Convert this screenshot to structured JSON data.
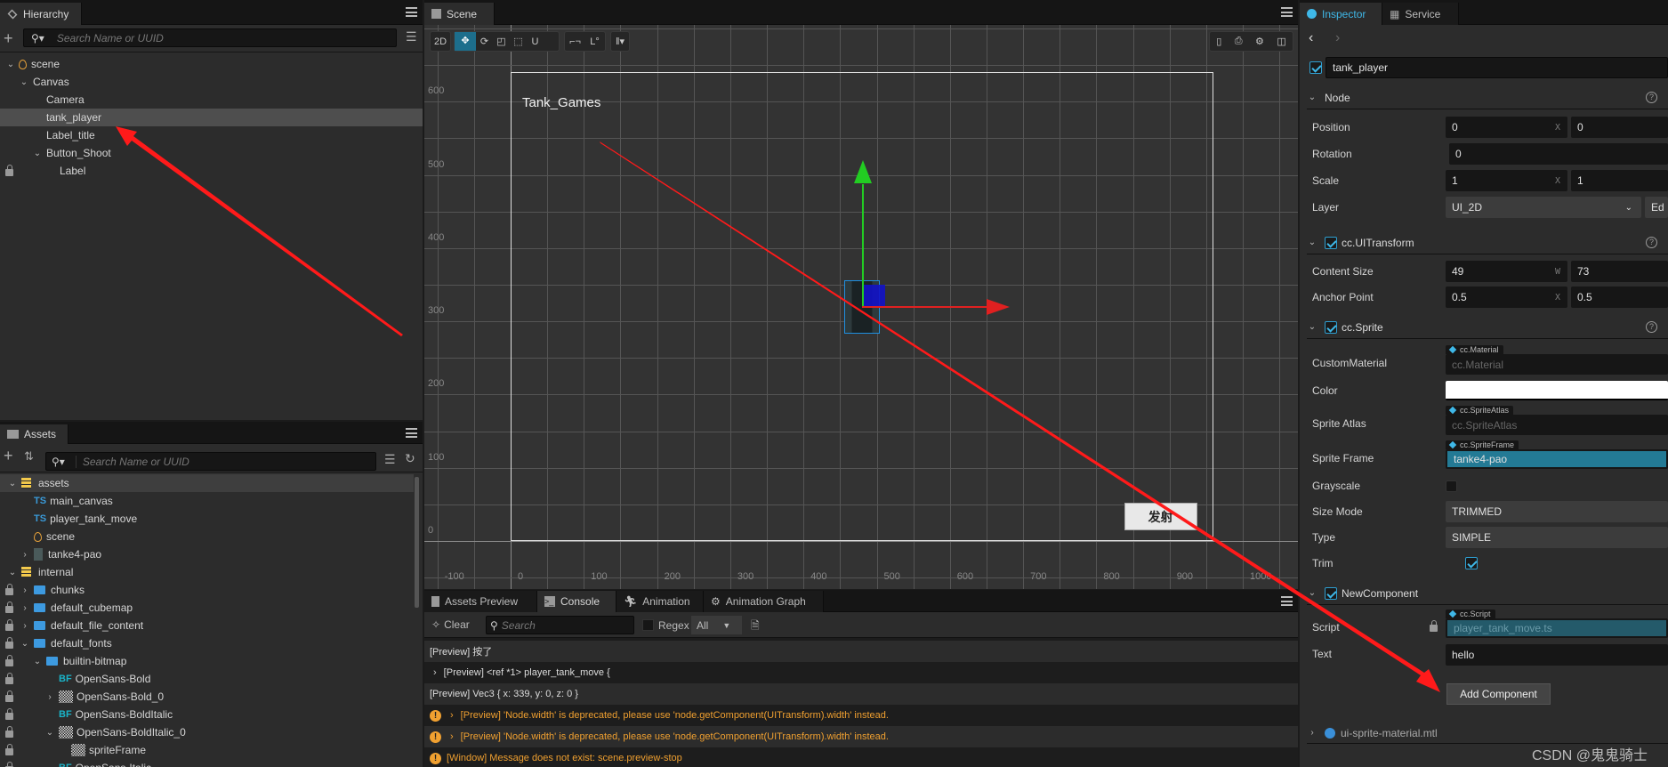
{
  "hierarchy": {
    "title": "Hierarchy",
    "search_placeholder": "Search Name or UUID",
    "items": [
      {
        "label": "scene",
        "indent": 0,
        "expanded": true,
        "icon": "scene-icon"
      },
      {
        "label": "Canvas",
        "indent": 1,
        "expanded": true
      },
      {
        "label": "Camera",
        "indent": 2
      },
      {
        "label": "tank_player",
        "indent": 2,
        "selected": true
      },
      {
        "label": "Label_title",
        "indent": 2
      },
      {
        "label": "Button_Shoot",
        "indent": 2,
        "expanded": true
      },
      {
        "label": "Label",
        "indent": 3,
        "locked": true
      }
    ]
  },
  "assets": {
    "title": "Assets",
    "search_placeholder": "Search Name or UUID",
    "items": [
      {
        "label": "assets",
        "type": "db",
        "indent": 0,
        "chevron": "down",
        "selected": true
      },
      {
        "label": "main_canvas",
        "type": "ts",
        "indent": 1
      },
      {
        "label": "player_tank_move",
        "type": "ts",
        "indent": 1
      },
      {
        "label": "scene",
        "type": "scene",
        "indent": 1
      },
      {
        "label": "tanke4-pao",
        "type": "image",
        "indent": 1,
        "chevron": "right"
      },
      {
        "label": "internal",
        "type": "db",
        "indent": 0,
        "chevron": "down"
      },
      {
        "label": "chunks",
        "type": "folder",
        "indent": 1,
        "chevron": "right",
        "locked": true
      },
      {
        "label": "default_cubemap",
        "type": "folder",
        "indent": 1,
        "chevron": "right",
        "locked": true
      },
      {
        "label": "default_file_content",
        "type": "folder",
        "indent": 1,
        "chevron": "right",
        "locked": true
      },
      {
        "label": "default_fonts",
        "type": "folder",
        "indent": 1,
        "chevron": "down",
        "locked": true
      },
      {
        "label": "builtin-bitmap",
        "type": "folder",
        "indent": 2,
        "chevron": "down",
        "locked": true
      },
      {
        "label": "OpenSans-Bold",
        "type": "bf",
        "indent": 3,
        "locked": true
      },
      {
        "label": "OpenSans-Bold_0",
        "type": "texture",
        "indent": 3,
        "chevron": "right",
        "locked": true
      },
      {
        "label": "OpenSans-BoldItalic",
        "type": "bf",
        "indent": 3,
        "locked": true
      },
      {
        "label": "OpenSans-BoldItalic_0",
        "type": "texture",
        "indent": 3,
        "chevron": "down",
        "locked": true
      },
      {
        "label": "spriteFrame",
        "type": "texture",
        "indent": 4,
        "locked": true
      },
      {
        "label": "OpenSans-Italic",
        "type": "bf",
        "indent": 3,
        "locked": true
      }
    ]
  },
  "scene": {
    "title": "Scene",
    "toolbar": {
      "mode_2d": "2D",
      "active_tool": "move"
    },
    "canvas_label": "Tank_Games",
    "button_label": "发射",
    "x_labels": [
      "-100",
      "0",
      "100",
      "200",
      "300",
      "400",
      "500",
      "600",
      "700",
      "800",
      "900",
      "1000"
    ],
    "y_labels": [
      "600",
      "500",
      "400",
      "300",
      "200",
      "100",
      "0"
    ]
  },
  "bottom": {
    "tabs": [
      "Assets Preview",
      "Console",
      "Animation",
      "Animation Graph"
    ],
    "active_tab": "Console",
    "clear_label": "Clear",
    "search_placeholder": "Search",
    "regex_label": "Regex",
    "filter_value": "All",
    "logs": [
      {
        "text": "[Preview] 按了",
        "level": "log"
      },
      {
        "text": "[Preview] <ref *1> player_tank_move {",
        "level": "log",
        "expandable": true
      },
      {
        "text": "[Preview] Vec3 { x: 339, y: 0, z: 0 }",
        "level": "log"
      },
      {
        "text": "[Preview] 'Node.width' is deprecated, please use 'node.getComponent(UITransform).width' instead.",
        "level": "warn",
        "expandable": true
      },
      {
        "text": "[Preview] 'Node.width' is deprecated, please use 'node.getComponent(UITransform).width' instead.",
        "level": "warn",
        "expandable": true
      },
      {
        "text": "[Window] Message does not exist: scene.preview-stop",
        "level": "warn"
      }
    ]
  },
  "inspector": {
    "tabs": [
      "Inspector",
      "Service"
    ],
    "node_name": "tank_player",
    "node_section": "Node",
    "position_label": "Position",
    "position": [
      "0",
      "0"
    ],
    "rotation_label": "Rotation",
    "rotation": "0",
    "scale_label": "Scale",
    "scale": [
      "1",
      "1"
    ],
    "layer_label": "Layer",
    "layer": "UI_2D",
    "edit_label": "Ed",
    "uitransform": "cc.UITransform",
    "content_size_label": "Content Size",
    "content_size": [
      "49",
      "73"
    ],
    "anchor_label": "Anchor Point",
    "anchor": [
      "0.5",
      "0.5"
    ],
    "sprite": "cc.Sprite",
    "custom_material_label": "CustomMaterial",
    "custom_material_tag": "cc.Material",
    "custom_material": "cc.Material",
    "color_label": "Color",
    "color": "#ffffff",
    "atlas_label": "Sprite Atlas",
    "atlas_tag": "cc.SpriteAtlas",
    "atlas": "cc.SpriteAtlas",
    "frame_label": "Sprite Frame",
    "frame_tag": "cc.SpriteFrame",
    "frame": "tanke4-pao",
    "grayscale_label": "Grayscale",
    "size_mode_label": "Size Mode",
    "size_mode": "TRIMMED",
    "type_label": "Type",
    "type": "SIMPLE",
    "trim_label": "Trim",
    "new_component": "NewComponent",
    "script_label": "Script",
    "script_tag": "cc.Script",
    "script": "player_tank_move.ts",
    "text_label": "Text",
    "text": "hello",
    "add_component": "Add Component",
    "material": "ui-sprite-material.mtl",
    "axis_x": "X",
    "axis_w": "W"
  },
  "watermark": "CSDN @鬼鬼骑士",
  "colors": {
    "accent": "#2e9fd1",
    "selected_frame": "#237a95",
    "warning": "#f0a030",
    "annotation": "#ff1a1a"
  }
}
